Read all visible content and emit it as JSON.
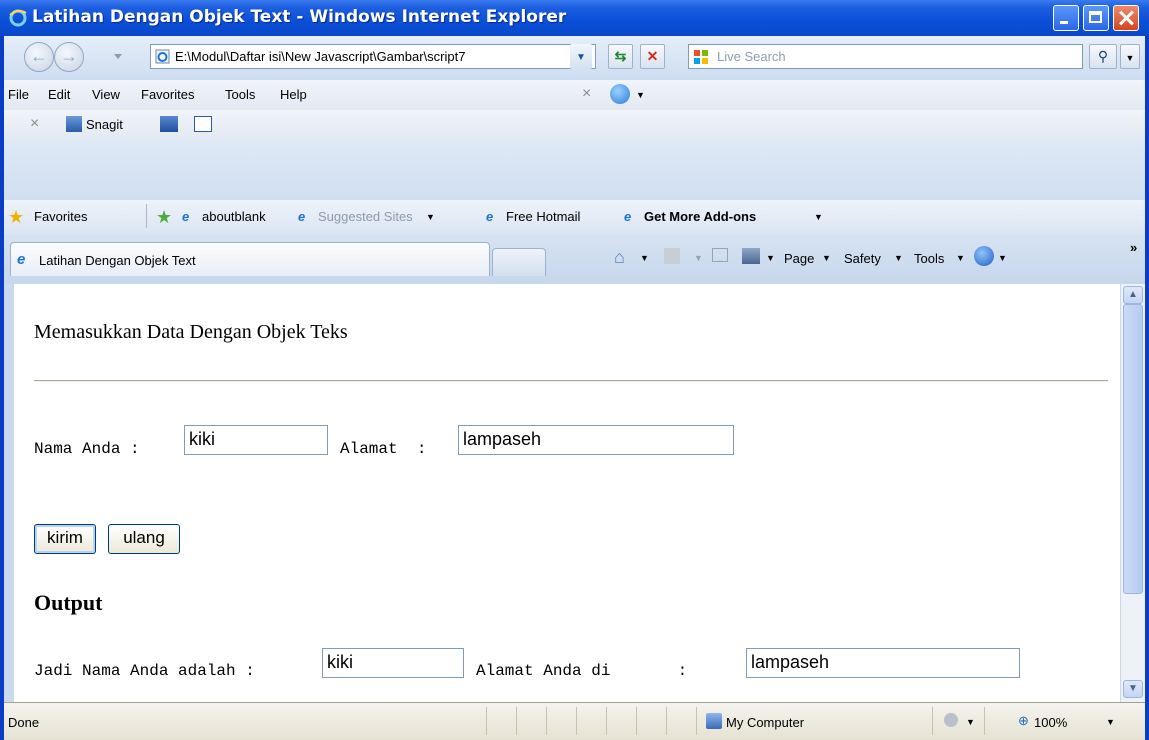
{
  "window": {
    "title": "Latihan Dengan Objek Text - Windows Internet Explorer"
  },
  "addressbar": {
    "url": "E:\\Modul\\Daftar isi\\New Javascript\\Gambar\\script7"
  },
  "search": {
    "placeholder": "Live Search"
  },
  "menu": {
    "items": [
      "File",
      "Edit",
      "View",
      "Favorites",
      "Tools",
      "Help"
    ]
  },
  "toolbar": {
    "snagit_label": "Snagit"
  },
  "favorites": {
    "label": "Favorites",
    "links": [
      "aboutblank",
      "Suggested Sites",
      "Free Hotmail",
      "Get More Add-ons"
    ]
  },
  "tab": {
    "title": "Latihan Dengan Objek Text"
  },
  "command_bar": {
    "page": "Page",
    "safety": "Safety",
    "tools": "Tools"
  },
  "page": {
    "heading": "Memasukkan Data Dengan Objek Teks",
    "nama_label": "Nama Anda :",
    "nama_value": "kiki",
    "alamat_label": "Alamat  :",
    "alamat_value": "lampaseh",
    "submit_label": "kirim",
    "reset_label": "ulang",
    "output_heading": "Output",
    "out_nama_label": "Jadi Nama Anda adalah :",
    "out_nama_value": "kiki",
    "out_alamat_label": "Alamat Anda di       :",
    "out_alamat_value": "lampaseh"
  },
  "statusbar": {
    "status": "Done",
    "zone": "My Computer",
    "zoom": "100%"
  }
}
